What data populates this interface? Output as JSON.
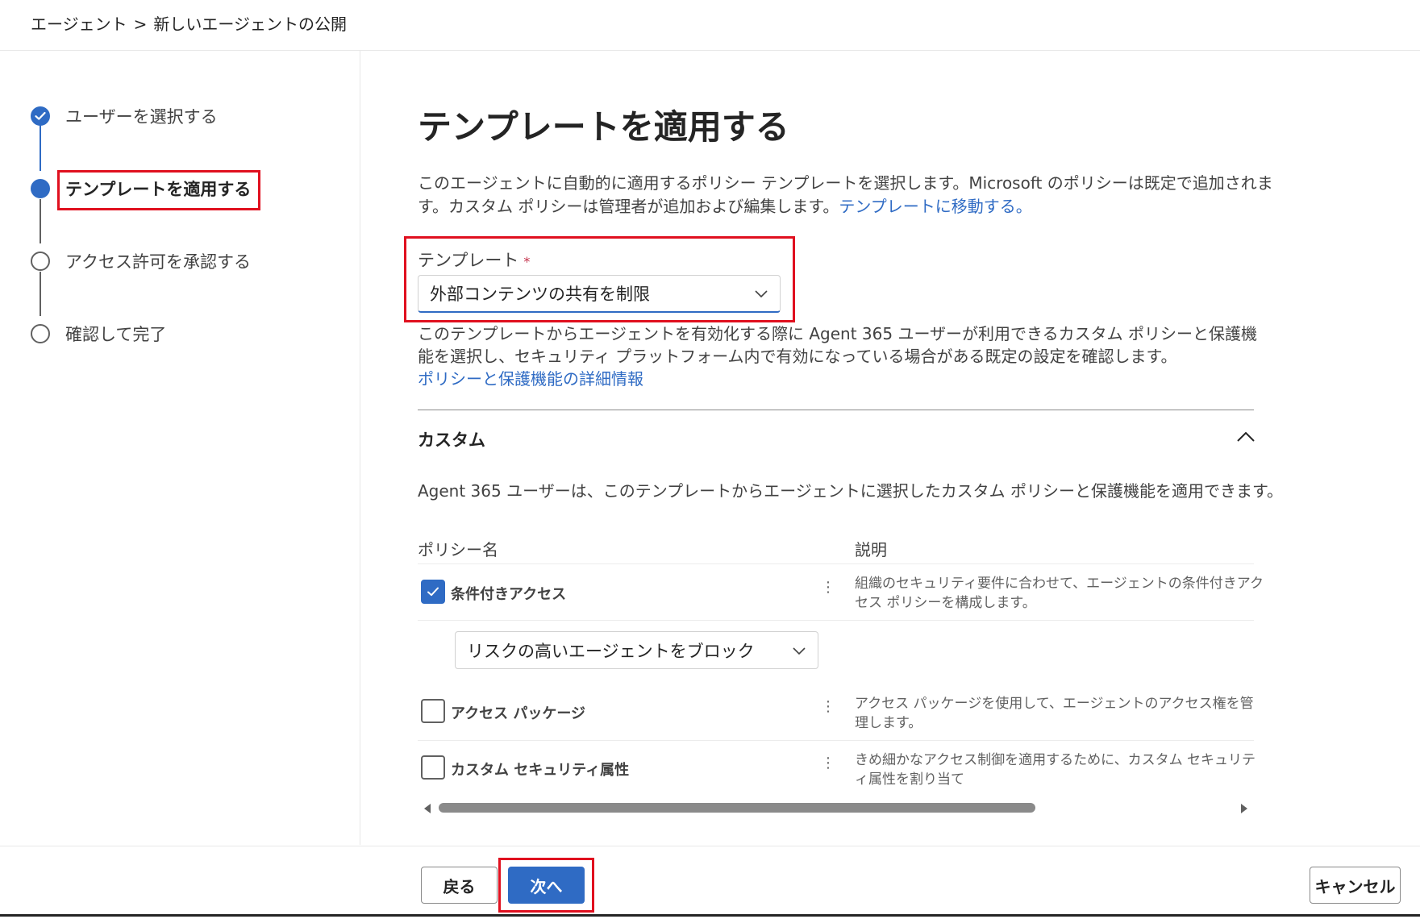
{
  "breadcrumb": {
    "parent": "エージェント",
    "separator": ">",
    "current": "新しいエージェントの公開"
  },
  "steps": [
    {
      "label": "ユーザーを選択する",
      "state": "completed"
    },
    {
      "label": "テンプレートを適用する",
      "state": "current"
    },
    {
      "label": "アクセス許可を承認する",
      "state": "pending"
    },
    {
      "label": "確認して完了",
      "state": "pending"
    }
  ],
  "main": {
    "title": "テンプレートを適用する",
    "description": "このエージェントに自動的に適用するポリシー テンプレートを選択します。Microsoft のポリシーは既定で追加されます。カスタム ポリシーは管理者が追加および編集します。",
    "description_link": "テンプレートに移動する。",
    "template_label": "テンプレート",
    "required_mark": "*",
    "template_value": "外部コンテンツの共有を制限",
    "help_text": "このテンプレートからエージェントを有効化する際に Agent 365 ユーザーが利用できるカスタム ポリシーと保護機能を選択し、セキュリティ プラットフォーム内で有効になっている場合がある既定の設定を確認します。",
    "help_link": "ポリシーと保護機能の詳細情報"
  },
  "custom_section": {
    "title": "カスタム",
    "description": "Agent 365 ユーザーは、このテンプレートからエージェントに選択したカスタム ポリシーと保護機能を適用できます。",
    "col_name": "ポリシー名",
    "col_desc": "説明",
    "policies": [
      {
        "name": "条件付きアクセス",
        "checked": true,
        "description": "組織のセキュリティ要件に合わせて、エージェントの条件付きアクセス ポリシーを構成します。",
        "sub_select": "リスクの高いエージェントをブロック"
      },
      {
        "name": "アクセス パッケージ",
        "checked": false,
        "description": "アクセス パッケージを使用して、エージェントのアクセス権を管理します。"
      },
      {
        "name": "カスタム セキュリティ属性",
        "checked": false,
        "description": "きめ細かなアクセス制御を適用するために、カスタム セキュリティ属性を割り当て"
      }
    ],
    "scroll_position": 0.0
  },
  "footer": {
    "back": "戻る",
    "next": "次へ",
    "cancel": "キャンセル"
  },
  "colors": {
    "accent": "#2f6bc4",
    "highlight": "#e0101f",
    "required": "#c4314b"
  }
}
